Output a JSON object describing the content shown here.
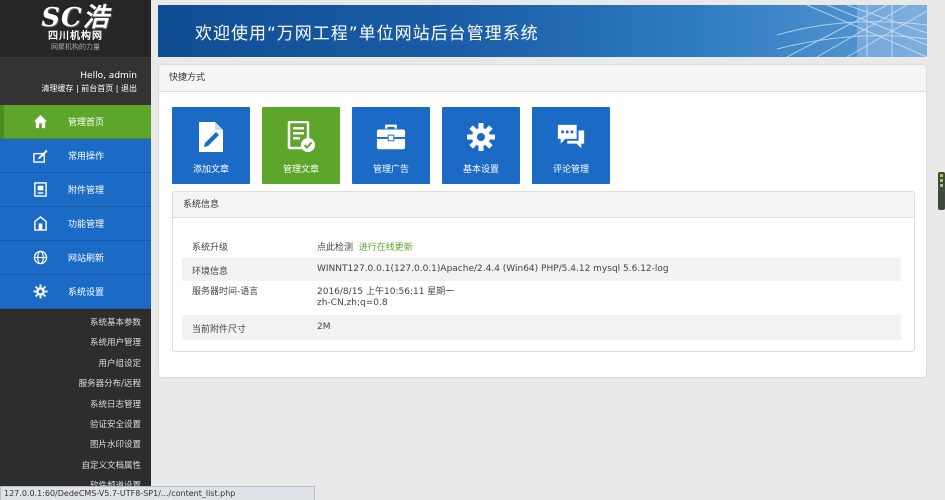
{
  "logo": {
    "main": "SC浩",
    "sub": "四川机构网",
    "tagline": "网聚机构的力量"
  },
  "user": {
    "greeting": "Hello, admin",
    "links": [
      "清理缓存",
      "前台首页",
      "退出"
    ]
  },
  "menu": [
    {
      "label": "管理首页",
      "icon": "home-icon",
      "active": true
    },
    {
      "label": "常用操作",
      "icon": "edit-icon",
      "active": false
    },
    {
      "label": "附件管理",
      "icon": "attachment-icon",
      "active": false
    },
    {
      "label": "功能管理",
      "icon": "function-icon",
      "active": false
    },
    {
      "label": "网站刷新",
      "icon": "globe-icon",
      "active": false
    },
    {
      "label": "系统设置",
      "icon": "gear-icon",
      "active": false
    }
  ],
  "submenu": [
    "系统基本参数",
    "系统用户管理",
    "用户组设定",
    "服务器分布/远程",
    "系统日志管理",
    "验证安全设置",
    "图片水印设置",
    "自定义文档属性",
    "软件频道设置"
  ],
  "banner": {
    "title": "欢迎使用“万网工程”单位网站后台管理系统"
  },
  "quick": {
    "title": "快捷方式",
    "tiles": [
      {
        "label": "添加文章",
        "icon": "add-article-icon",
        "color": "#1b6bc6"
      },
      {
        "label": "管理文章",
        "icon": "manage-article-icon",
        "color": "#5ea62b"
      },
      {
        "label": "管理广告",
        "icon": "briefcase-icon",
        "color": "#1b6bc6"
      },
      {
        "label": "基本设置",
        "icon": "settings-gear-icon",
        "color": "#1b6bc6"
      },
      {
        "label": "评论管理",
        "icon": "comments-icon",
        "color": "#1b6bc6"
      }
    ]
  },
  "sysinfo": {
    "title": "系统信息",
    "rows": [
      {
        "key": "系统升级",
        "value": "点此检测",
        "link": "进行在线更新"
      },
      {
        "key": "环境信息",
        "value": "WINNT127.0.0.1(127.0.0.1)Apache/2.4.4 (Win64) PHP/5.4.12 mysql 5.6.12-log"
      },
      {
        "key": "服务器时间-语言",
        "value": "2016/8/15 上午10:56:11 星期一",
        "value2": "zh-CN,zh;q=0.8"
      },
      {
        "key": "当前附件尺寸",
        "value": "2M"
      }
    ]
  },
  "statusbar": "127.0.0.1:60/DedeCMS-V5.7-UTF8-SP1/.../content_list.php",
  "colors": {
    "blue": "#1b6bc6",
    "green": "#5ea62b",
    "sidebar": "#2d2d2d"
  }
}
